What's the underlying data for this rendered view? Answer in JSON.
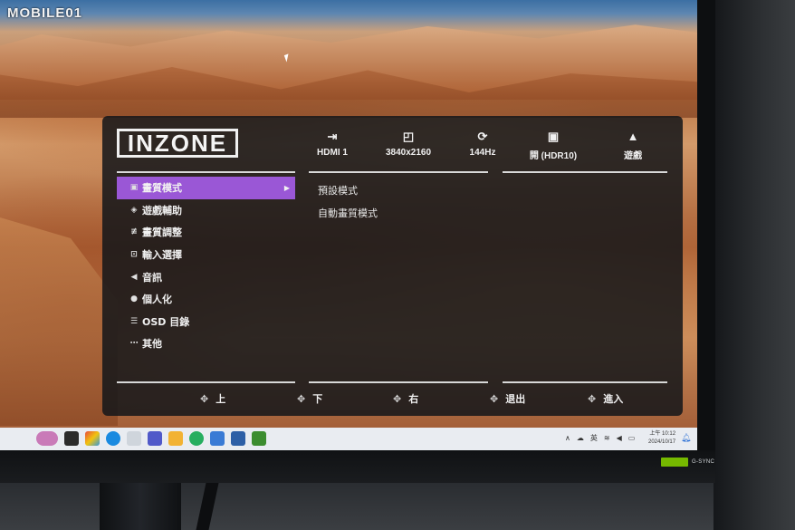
{
  "watermark": "MOBILE01",
  "osd": {
    "logo": "INZONE",
    "status": [
      {
        "icon": "input-icon",
        "glyph": "⇥",
        "label": "HDMI 1"
      },
      {
        "icon": "resolution-icon",
        "glyph": "◰",
        "label": "3840x2160"
      },
      {
        "icon": "refresh-icon",
        "glyph": "⟳",
        "label": "144Hz"
      },
      {
        "icon": "hdr-icon",
        "glyph": "▣",
        "label": "開 (HDR10)"
      },
      {
        "icon": "picture-icon",
        "glyph": "▲",
        "label": "遊戲"
      }
    ],
    "menu": [
      {
        "icon": "picture-mode-icon",
        "glyph": "▣",
        "label": "畫質模式",
        "active": true
      },
      {
        "icon": "gamepad-icon",
        "glyph": "◈",
        "label": "遊戲輔助"
      },
      {
        "icon": "sliders-icon",
        "glyph": "≢",
        "label": "畫質調整"
      },
      {
        "icon": "input-select-icon",
        "glyph": "⊡",
        "label": "輸入選擇"
      },
      {
        "icon": "speaker-icon",
        "glyph": "◀",
        "label": "音訊"
      },
      {
        "icon": "person-icon",
        "glyph": "●",
        "label": "個人化"
      },
      {
        "icon": "list-icon",
        "glyph": "☰",
        "label": "OSD 目錄"
      },
      {
        "icon": "more-icon",
        "glyph": "⋯",
        "label": "其他"
      }
    ],
    "submenu": [
      "預設模式",
      "自動畫質模式"
    ],
    "footer": [
      {
        "icon": "dpad-up-icon",
        "glyph": "✥",
        "label": "上"
      },
      {
        "icon": "dpad-down-icon",
        "glyph": "✥",
        "label": "下"
      },
      {
        "icon": "dpad-right-icon",
        "glyph": "✥",
        "label": "右"
      },
      {
        "icon": "dpad-back-icon",
        "glyph": "✥",
        "label": "退出"
      },
      {
        "icon": "dpad-enter-icon",
        "glyph": "✥",
        "label": "進入"
      }
    ]
  },
  "taskbar": {
    "ime": "英",
    "time": "上午 10:12",
    "date": "2024/10/17"
  },
  "monitor": {
    "badge": "G-SYNC"
  },
  "colors": {
    "accent": "#9a57d6",
    "osd_bg": "#14161a"
  }
}
